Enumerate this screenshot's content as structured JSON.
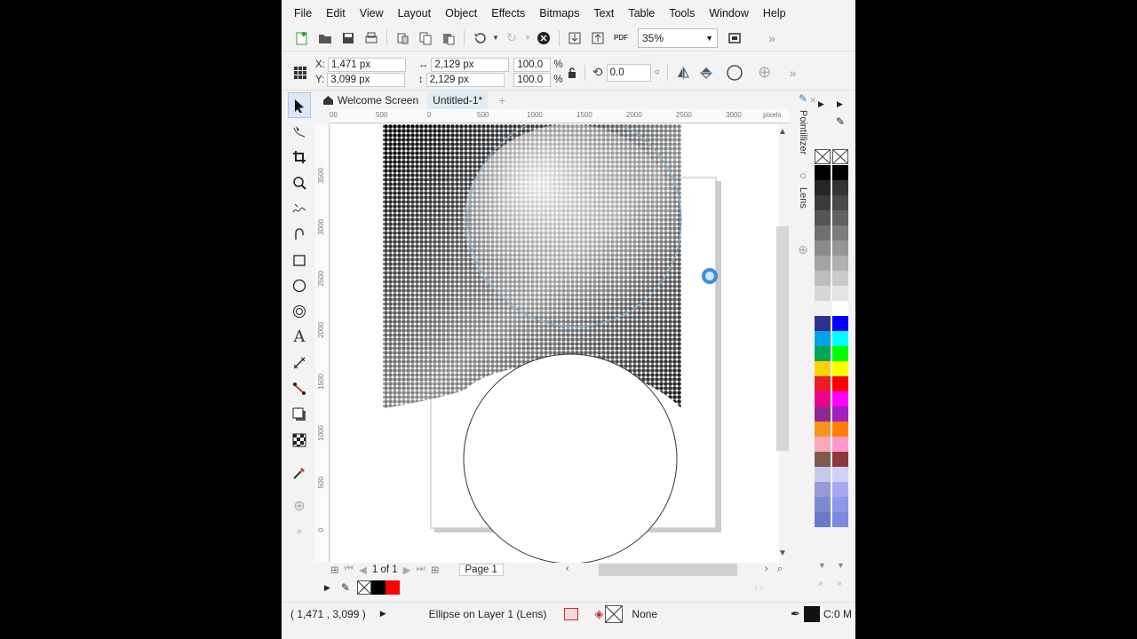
{
  "menu": [
    "File",
    "Edit",
    "View",
    "Layout",
    "Object",
    "Effects",
    "Bitmaps",
    "Text",
    "Table",
    "Tools",
    "Window",
    "Help"
  ],
  "toolbar": {
    "zoom": "35%"
  },
  "propbar": {
    "x": "1,471 px",
    "y": "3,099 px",
    "x_label": "X:",
    "y_label": "Y:",
    "width": "2,129 px",
    "height": "2,129 px",
    "scale_w": "100.0",
    "scale_h": "100.0",
    "percent": "%",
    "rotation": "0.0"
  },
  "doc_tabs": {
    "welcome": "Welcome Screen",
    "current": "Untitled-1*"
  },
  "ruler": {
    "top_ticks": [
      "00",
      "500",
      "0",
      "500",
      "1000",
      "1500",
      "2000",
      "2500",
      "3000"
    ],
    "units": "pixels",
    "left_ticks": [
      "3500",
      "3000",
      "2500",
      "2000",
      "1500",
      "1000",
      "500",
      "0"
    ]
  },
  "page_nav": {
    "position": "1 of 1",
    "page": "Page 1"
  },
  "dockers": [
    "Pointillizer",
    "Lens"
  ],
  "palette_colors": [
    [
      "#000000",
      "#000000"
    ],
    [
      "#262626",
      "#333333"
    ],
    [
      "#3c3c3c",
      "#4a4a4a"
    ],
    [
      "#555555",
      "#626262"
    ],
    [
      "#707070",
      "#7d7d7d"
    ],
    [
      "#8a8a8a",
      "#969696"
    ],
    [
      "#a3a3a3",
      "#b0b0b0"
    ],
    [
      "#bdbdbd",
      "#cacaca"
    ],
    [
      "#d6d6d6",
      "#e3e3e3"
    ],
    [
      "#f0f0f0",
      "#ffffff"
    ],
    [
      "#2e3192",
      "#0000ff"
    ],
    [
      "#00a2e8",
      "#00ffff"
    ],
    [
      "#00a651",
      "#00ff00"
    ],
    [
      "#ffd200",
      "#ffff00"
    ],
    [
      "#ed1c24",
      "#ff0000"
    ],
    [
      "#ec008c",
      "#ff00ff"
    ],
    [
      "#92278f",
      "#a020c0"
    ],
    [
      "#f7941d",
      "#ff8000"
    ],
    [
      "#f9a8b8",
      "#ff99cc"
    ],
    [
      "#7a5c48",
      "#8b3a3a"
    ],
    [
      "#c8c8e8",
      "#d0d0f8"
    ],
    [
      "#9a9ad8",
      "#a8a8f0"
    ],
    [
      "#7a8ad0",
      "#8a9ae8"
    ],
    [
      "#6a7ac8",
      "#7a8ae0"
    ]
  ],
  "status": {
    "coords": "( 1,471 , 3,099 )",
    "object": "Ellipse on Layer 1 (Lens)",
    "outline": "None",
    "fill_info": "C:0 M"
  },
  "colors": {
    "accent": "#3a8fd8",
    "ellipse_outline": "#7fb4d4"
  }
}
